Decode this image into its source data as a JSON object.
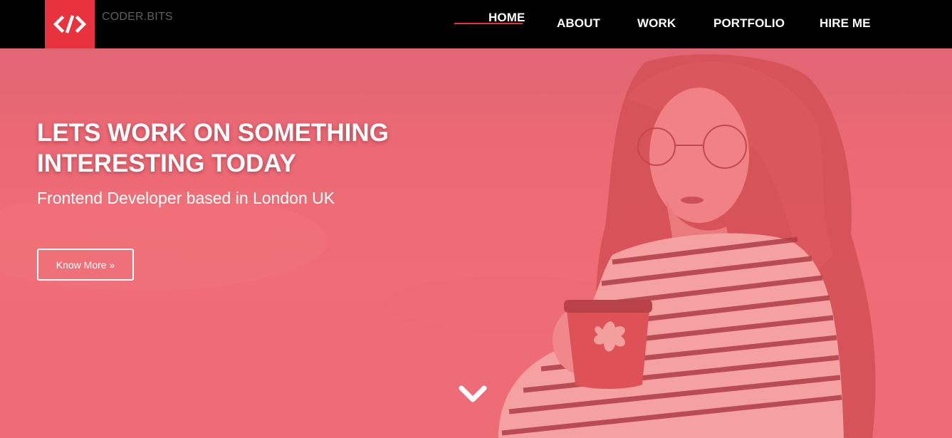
{
  "brand": {
    "name": "CODER.BITS",
    "logo_icon": "code-icon",
    "accent": "#e8333f"
  },
  "nav": {
    "items": [
      {
        "label": "HOME",
        "active": true
      },
      {
        "label": "ABOUT"
      },
      {
        "label": "WORK"
      },
      {
        "label": "PORTFOLIO"
      },
      {
        "label": "HIRE ME"
      }
    ]
  },
  "hero": {
    "title_line1": "LETS WORK ON SOMETHING",
    "title_line2": "INTERESTING TODAY",
    "subtitle": "Frontend Developer based in London UK",
    "cta_label": "Know More »",
    "scroll_icon": "chevron-down-icon",
    "overlay_color": "#ee6a75"
  }
}
